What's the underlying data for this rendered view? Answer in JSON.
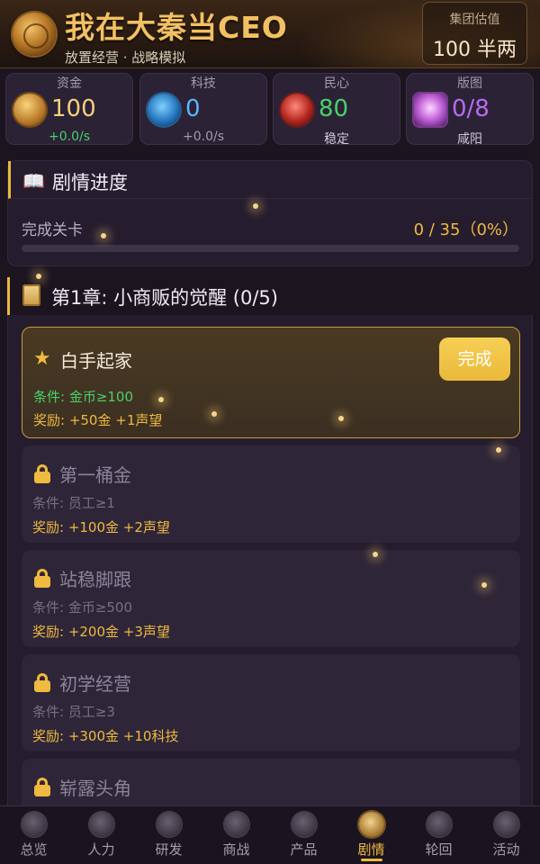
{
  "header": {
    "title": "我在大秦当CEO",
    "subtitle": "放置经营 · 战略模拟",
    "valuation_label": "集团估值",
    "valuation_value": "100 半两"
  },
  "stats": [
    {
      "label": "资金",
      "value": "100",
      "sub": "+0.0/s",
      "icon": "coin-icon",
      "value_color": "#f4d17a",
      "sub_color": "#48d16b"
    },
    {
      "label": "科技",
      "value": "0",
      "sub": "+0.0/s",
      "icon": "tech-scroll-icon",
      "value_color": "#5ab6ff",
      "sub_color": "#a59aae"
    },
    {
      "label": "民心",
      "value": "80",
      "sub": "稳定",
      "icon": "heart-icon",
      "value_color": "#48d16b",
      "sub_color": "#d0c8d8"
    },
    {
      "label": "版图",
      "value": "0/8",
      "sub": "咸阳",
      "icon": "map-icon",
      "value_color": "#b66cf0",
      "sub_color": "#d0c8d8"
    }
  ],
  "story_progress": {
    "title": "剧情进度",
    "label": "完成关卡",
    "value": "0 / 35（0%）",
    "fraction": 0
  },
  "chapter": {
    "title": "第1章: 小商贩的觉醒 (0/5)",
    "levels": [
      {
        "name": "白手起家",
        "condition": "条件: 金币≥100",
        "reward": "奖励: +50金 +1声望",
        "status": "active",
        "button_label": "完成"
      },
      {
        "name": "第一桶金",
        "condition": "条件: 员工≥1",
        "reward": "奖励: +100金 +2声望",
        "status": "locked"
      },
      {
        "name": "站稳脚跟",
        "condition": "条件: 金币≥500",
        "reward": "奖励: +200金 +3声望",
        "status": "locked"
      },
      {
        "name": "初学经营",
        "condition": "条件: 员工≥3",
        "reward": "奖励: +300金 +10科技",
        "status": "locked"
      },
      {
        "name": "崭露头角",
        "condition": "",
        "reward": "",
        "status": "locked"
      }
    ]
  },
  "nav": {
    "items": [
      {
        "label": "总览",
        "icon": "overview-icon"
      },
      {
        "label": "人力",
        "icon": "staff-icon"
      },
      {
        "label": "研发",
        "icon": "research-icon"
      },
      {
        "label": "商战",
        "icon": "battle-icon"
      },
      {
        "label": "产品",
        "icon": "product-icon"
      },
      {
        "label": "剧情",
        "icon": "story-icon"
      },
      {
        "label": "轮回",
        "icon": "rebirth-icon"
      },
      {
        "label": "活动",
        "icon": "event-icon"
      }
    ],
    "active_index": 5
  }
}
